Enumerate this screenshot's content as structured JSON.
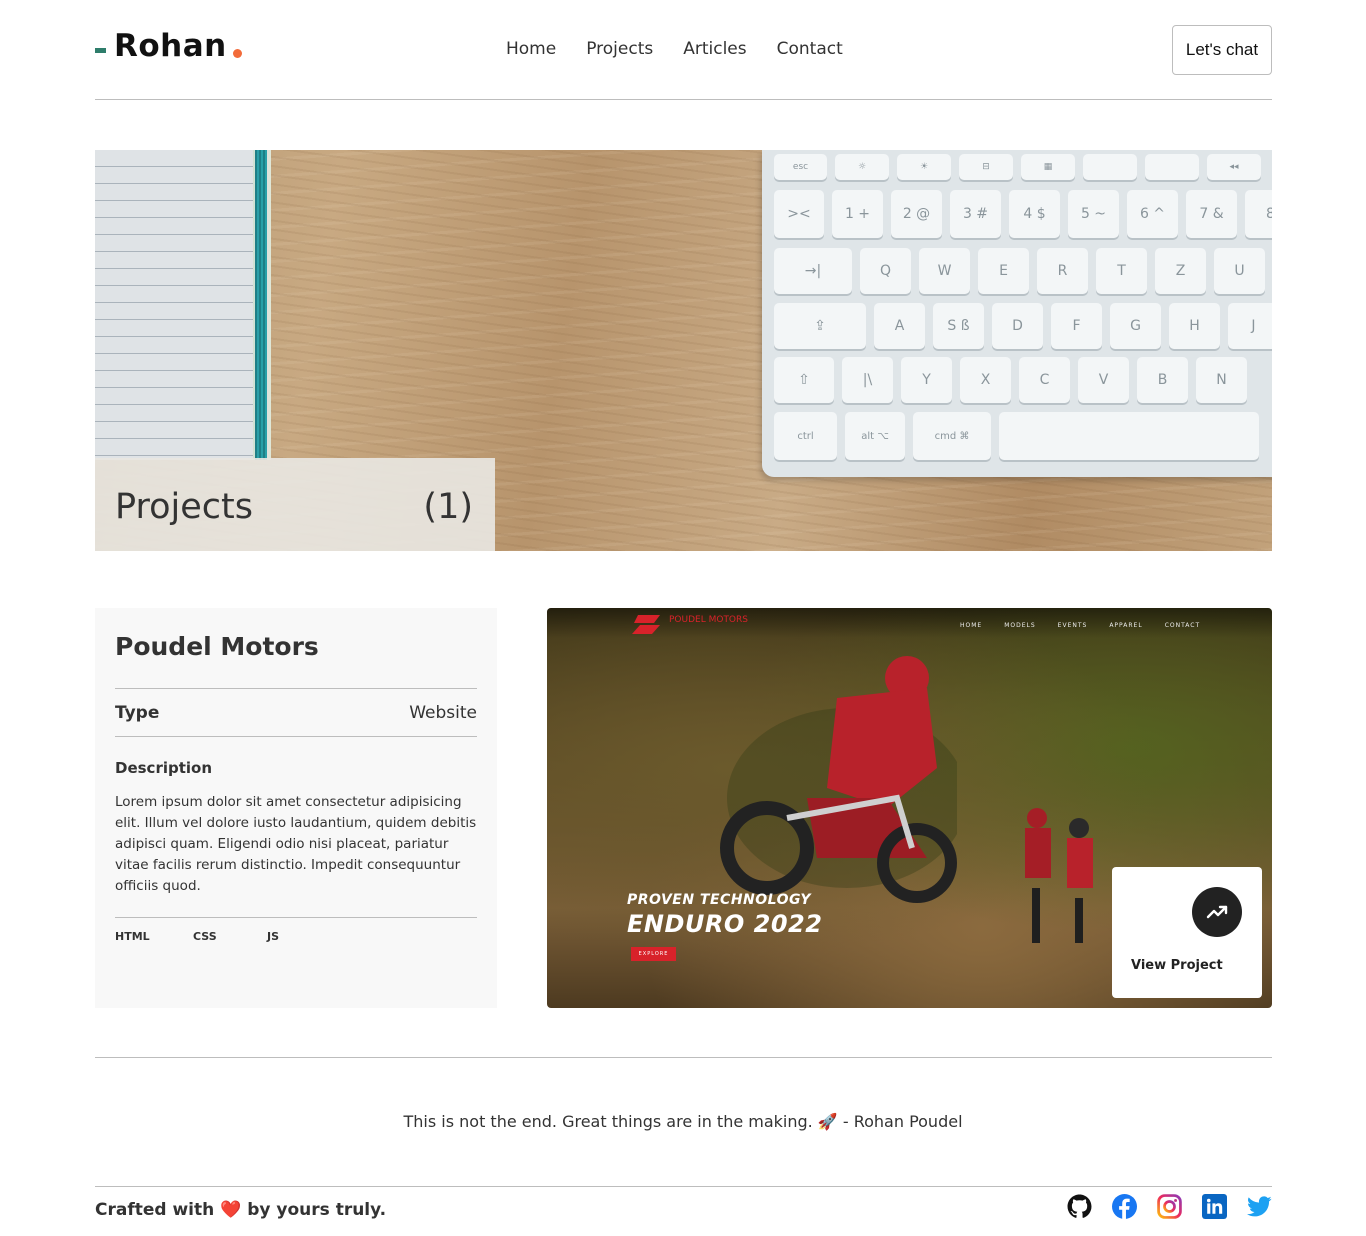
{
  "header": {
    "logo_text": "Rohan",
    "nav": [
      "Home",
      "Projects",
      "Articles",
      "Contact"
    ],
    "cta_label": "Let's chat"
  },
  "hero": {
    "title": "Projects",
    "count": "(1)",
    "keyboard_keys": {
      "row1": [
        "esc",
        "☼",
        "☀",
        "⊟",
        "▦",
        "",
        "",
        "◂◂"
      ],
      "row2": [
        "><",
        "1 +",
        "2 @",
        "3 #",
        "4 $",
        "5 ~",
        "6 ^",
        "7 &",
        "8"
      ],
      "row3": [
        "→|",
        "Q",
        "W",
        "E",
        "R",
        "T",
        "Z",
        "U"
      ],
      "row4": [
        "⇪",
        "A",
        "S ß",
        "D",
        "F",
        "G",
        "H",
        "J"
      ],
      "row5": [
        "⇧",
        "|\\",
        "Y",
        "X",
        "C",
        "V",
        "B",
        "N"
      ],
      "row6": [
        "ctrl",
        "alt ⌥",
        "cmd ⌘",
        ""
      ]
    }
  },
  "project": {
    "title": "Poudel Motors",
    "type_label": "Type",
    "type_value": "Website",
    "description_label": "Description",
    "description": "Lorem ipsum dolor sit amet consectetur adipisicing elit. Illum vel dolore iusto laudantium, quidem debitis adipisci quam. Eligendi odio nisi placeat, pariatur vitae facilis rerum distinctio. Impedit consequuntur officiis quod.",
    "tech": [
      "HTML",
      "CSS",
      "JS"
    ],
    "image": {
      "brand": "POUDEL MOTORS",
      "nav": [
        "HOME",
        "MODELS",
        "EVENTS",
        "APPAREL",
        "CONTACT"
      ],
      "subtitle": "PROVEN TECHNOLOGY",
      "headline": "ENDURO 2022",
      "cta": "EXPLORE"
    },
    "view_label": "View Project"
  },
  "footer": {
    "tagline": "This is not the end. Great things are in the making. 🚀 - Rohan Poudel",
    "crafted": "Crafted with ❤️ by yours truly.",
    "socials": [
      "github-icon",
      "facebook-icon",
      "instagram-icon",
      "linkedin-icon",
      "twitter-icon"
    ]
  },
  "colors": {
    "accent_dash": "#2e7d6b",
    "accent_dot": "#f26b3a",
    "brand_red": "#d8222a"
  }
}
